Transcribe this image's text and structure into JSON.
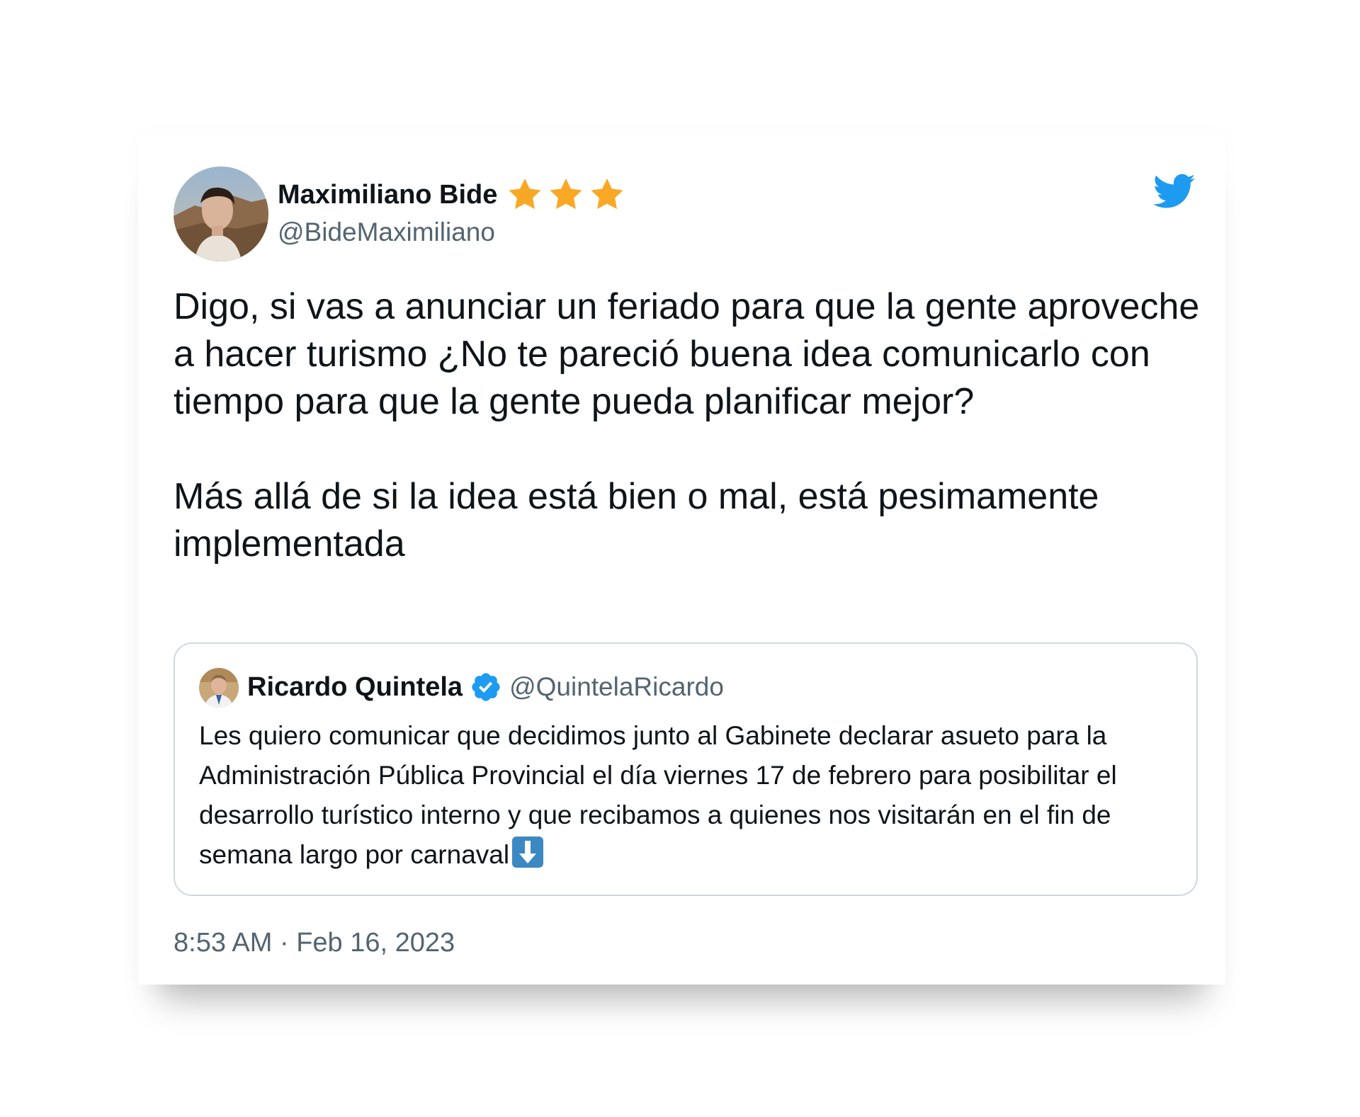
{
  "tweet": {
    "author": {
      "name": "Maximiliano Bide",
      "handle": "@BideMaximiliano",
      "badge_icons": [
        "star-icon",
        "star-icon",
        "star-icon"
      ],
      "badge_color": "#f9a825"
    },
    "brand_icon": "twitter-bird-icon",
    "brand_color": "#1d9bf0",
    "paragraphs": [
      "Digo, si vas a anunciar un feriado para que la gente aproveche a hacer turismo ¿No te pareció buena idea comunicarlo con tiempo para que la gente pueda planificar mejor?",
      "Más allá de si la idea está bien o mal, está pesimamente implementada"
    ],
    "quoted": {
      "name": "Ricardo Quintela",
      "verified_icon": "verified-badge-icon",
      "handle": "@QuintelaRicardo",
      "text": "Les quiero comunicar que decidimos junto al Gabinete declarar asueto para la Administración Pública Provincial el día viernes 17 de febrero para posibilitar el desarrollo turístico interno y que recibamos a quienes nos visitarán en el fin de semana largo por carnaval",
      "trailing_icon": "down-arrow-emoji-icon"
    },
    "timestamp": "8:53 AM · Feb 16, 2023"
  },
  "colors": {
    "text": "#0f1419",
    "secondary_text": "#536471",
    "border": "#cfd9de",
    "accent": "#1d9bf0"
  }
}
